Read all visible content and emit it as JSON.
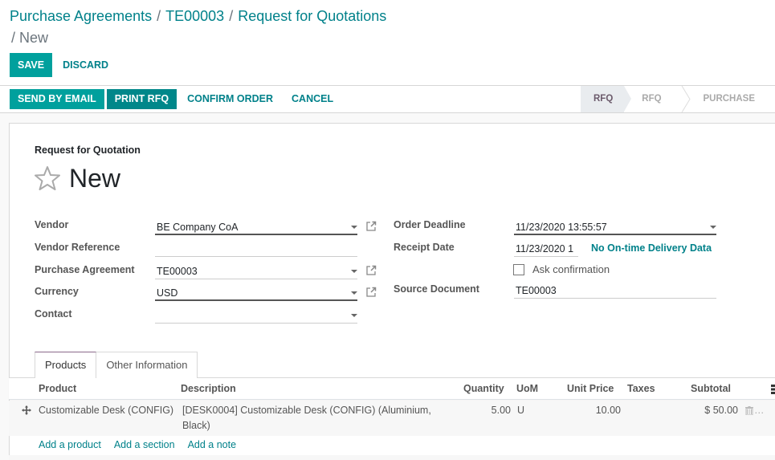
{
  "breadcrumb": {
    "items": [
      "Purchase Agreements",
      "TE00003",
      "Request for Quotations"
    ],
    "current": "New",
    "separator": "/"
  },
  "toolbar": {
    "save_label": "SAVE",
    "discard_label": "DISCARD"
  },
  "statusbar": {
    "actions": [
      "SEND BY EMAIL",
      "PRINT RFQ",
      "CONFIRM ORDER",
      "CANCEL"
    ],
    "stages": [
      {
        "label": "RFQ",
        "active": true
      },
      {
        "label": "RFQ SENT",
        "active": false
      },
      {
        "label": "PURCHASE ORDER",
        "active": false
      }
    ]
  },
  "form": {
    "subtitle": "Request for Quotation",
    "title": "New",
    "left_fields": [
      {
        "label": "Vendor",
        "value": "BE Company CoA"
      },
      {
        "label": "Vendor Reference",
        "value": ""
      },
      {
        "label": "Purchase Agreement",
        "value": "TE00003"
      },
      {
        "label": "Currency",
        "value": "USD"
      },
      {
        "label": "Contact",
        "value": ""
      }
    ],
    "right_fields": {
      "order_deadline_label": "Order Deadline",
      "order_deadline_value": "11/23/2020 13:55:57",
      "receipt_date_label": "Receipt Date",
      "receipt_date_value": "11/23/2020 1",
      "ontime_text": "No On-time Delivery Data",
      "ask_confirmation_label": "Ask confirmation",
      "ask_confirmation_checked": false,
      "source_document_label": "Source Document",
      "source_document_value": "TE00003"
    }
  },
  "tabs": [
    {
      "label": "Products",
      "active": true
    },
    {
      "label": "Other Information",
      "active": false
    }
  ],
  "lines": {
    "columns": [
      "Product",
      "Description",
      "Quantity",
      "UoM",
      "Unit Price",
      "Taxes",
      "Subtotal"
    ],
    "rows": [
      {
        "product": "Customizable Desk (CONFIG)",
        "description_line1": "[DESK0004] Customizable Desk (CONFIG) (Aluminium,",
        "description_line2": "Black)",
        "quantity": "5.00",
        "uom": "U",
        "unit_price": "10.00",
        "taxes": "",
        "subtotal": "$ 50.00"
      }
    ],
    "add_links": [
      "Add a product",
      "Add a section",
      "Add a note"
    ]
  },
  "colors": {
    "primary": "#00a09d",
    "link": "#00818a",
    "active_stage_bg": "#e9ecef"
  }
}
